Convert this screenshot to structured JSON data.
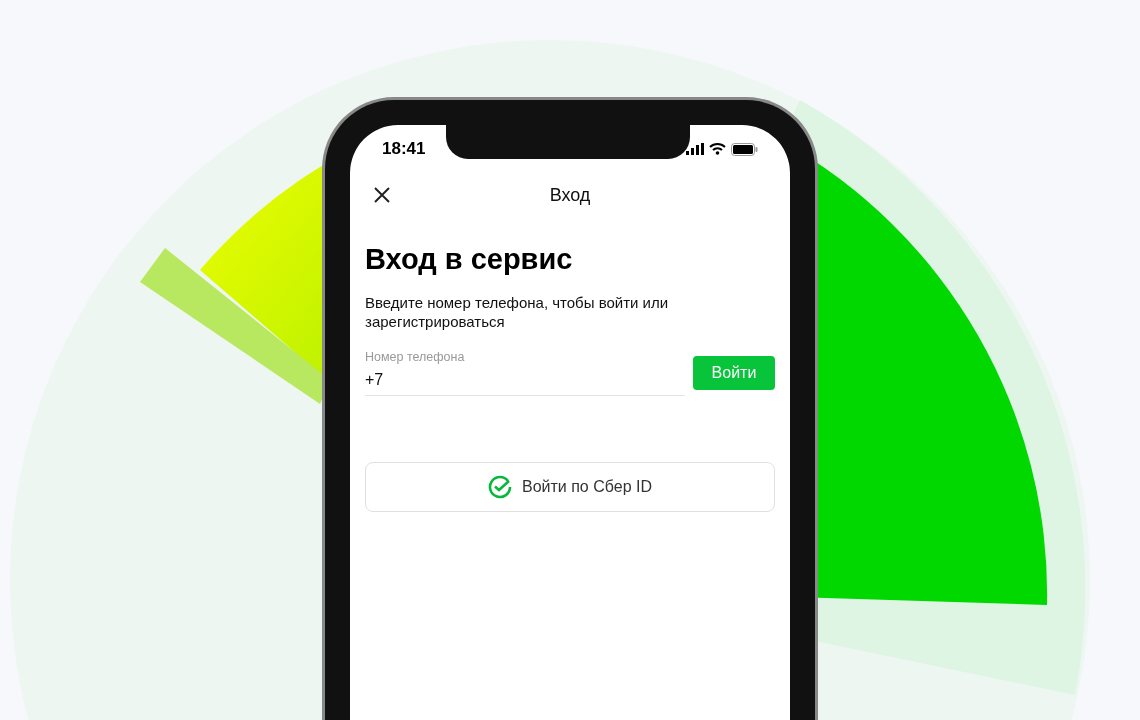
{
  "status_bar": {
    "time": "18:41"
  },
  "header": {
    "title": "Вход"
  },
  "heading": "Вход в сервис",
  "description": "Введите номер телефона, чтобы войти или зарегистрироваться",
  "phone_field": {
    "label": "Номер телефона",
    "value": "+7"
  },
  "submit_button": "Войти",
  "sber_id_button": "Войти по Сбер ID"
}
